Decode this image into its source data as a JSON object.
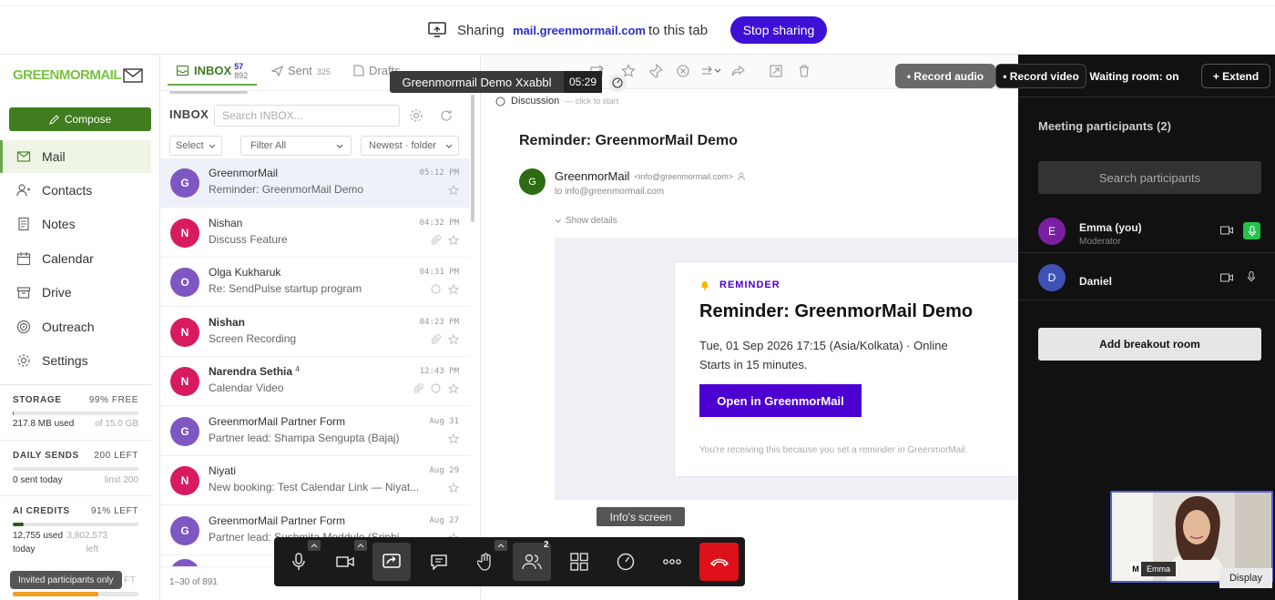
{
  "share_bar": {
    "prefix": "Sharing",
    "domain": "mail.greenmormail.com",
    "suffix": "to this tab",
    "stop_label": "Stop sharing"
  },
  "brand": {
    "logo_text": "GREENMORMAIL",
    "accent": "#3f7d20",
    "logo_color": "#7ac142"
  },
  "compose_label": "Compose",
  "nav": [
    {
      "label": "Mail",
      "icon": "mail-icon",
      "active": true
    },
    {
      "label": "Contacts",
      "icon": "contacts-icon"
    },
    {
      "label": "Notes",
      "icon": "notes-icon"
    },
    {
      "label": "Calendar",
      "icon": "calendar-icon"
    },
    {
      "label": "Drive",
      "icon": "drive-icon"
    },
    {
      "label": "Outreach",
      "icon": "outreach-icon"
    },
    {
      "label": "Settings",
      "icon": "settings-icon"
    }
  ],
  "stats": {
    "storage": {
      "label": "STORAGE",
      "right": "99% FREE",
      "used": "217.8 MB used",
      "limit": "of 15.0 GB",
      "fill": 0.01
    },
    "sends": {
      "label": "DAILY SENDS",
      "right": "200 LEFT",
      "used": "0 sent today",
      "limit": "limit 200",
      "fill": 0.0
    },
    "ai": {
      "label": "AI CREDITS",
      "right": "91% LEFT",
      "used": "12,755 used",
      "used2": "today",
      "limit": "3,802,573",
      "limit2": "left",
      "fill": 0.09
    },
    "fourth": {
      "right": "FT",
      "fill": 0.68
    }
  },
  "invited_tooltip": "Invited participants only",
  "tabs": {
    "inbox": "INBOX",
    "inbox_new": "57",
    "inbox_total": "892",
    "sent": "Sent",
    "sent_count": "325",
    "drafts": "Drafts"
  },
  "list": {
    "title": "INBOX",
    "search_placeholder": "Search INBOX...",
    "filters": {
      "select": "Select",
      "filter": "Filter All",
      "sort": "Newest · folder"
    },
    "footer": "1–30 of 891",
    "rows": [
      {
        "initial": "G",
        "from": "GreenmorMail",
        "subject": "Reminder: GreenmorMail Demo",
        "time": "05:12 PM",
        "color": "#7e57c2",
        "selected": true,
        "bold": false
      },
      {
        "initial": "N",
        "from": "Nishan",
        "subject": "Discuss Feature",
        "time": "04:32 PM",
        "color": "#d81b60"
      },
      {
        "initial": "O",
        "from": "Olga Kukharuk",
        "subject": "Re: SendPulse startup program",
        "time": "04:31 PM",
        "color": "#7e57c2"
      },
      {
        "initial": "N",
        "from": "Nishan",
        "subject": "Screen Recording",
        "time": "04:23 PM",
        "color": "#d81b60",
        "bold": true
      },
      {
        "initial": "N",
        "from": "Narendra Sethia",
        "count": "4",
        "subject": "Calendar Video",
        "time": "12:43 PM",
        "color": "#d81b60",
        "bold": true
      },
      {
        "initial": "G",
        "from": "GreenmorMail Partner Form",
        "subject": "Partner lead: Shampa Sengupta (Bajaj)",
        "time": "Aug 31",
        "color": "#7e57c2"
      },
      {
        "initial": "N",
        "from": "Niyati",
        "subject": "New booking: Test Calendar Link — Niyat...",
        "time": "Aug 29",
        "color": "#d81b60"
      },
      {
        "initial": "G",
        "from": "GreenmorMail Partner Form",
        "subject": "Partner lead: Sushmita Moddule (Sriphi...",
        "time": "Aug 27",
        "color": "#7e57c2"
      }
    ]
  },
  "overlay": {
    "meeting_title": "Greenmormail Demo Xxabbl",
    "timer": "05:29",
    "screen_label": "Info's screen"
  },
  "pane": {
    "discussion": "Discussion",
    "discussion_hint": "— click to start",
    "subject": "Reminder: GreenmorMail Demo",
    "sender_initial": "G",
    "sender_name": "GreenmorMail",
    "sender_email": "<info@greenmormail.com>",
    "to": "to info@greenmormail.com",
    "show_details": "Show details",
    "card": {
      "tag": "REMINDER",
      "title": "Reminder: GreenmorMail Demo",
      "line1": "Tue, 01 Sep 2026 17:15 (Asia/Kolkata) · Online",
      "line2": "Starts in 15 minutes.",
      "button": "Open in GreenmorMail",
      "footer": "You're receiving this because you set a reminder in GreenmorMail.",
      "button_color": "#4b00d1"
    }
  },
  "meeting": {
    "record_audio": "• Record audio",
    "record_video": "• Record video",
    "waiting": "Waiting room: on",
    "extend": "+ Extend",
    "participants_title": "Meeting participants (2)",
    "search_placeholder": "Search participants",
    "people": [
      {
        "initial": "E",
        "name": "Emma (you)",
        "role": "Moderator",
        "color": "#7b1fa2",
        "mic_on": true
      },
      {
        "initial": "D",
        "name": "Daniel",
        "role": "",
        "color": "#3f51b5",
        "mic_on": false
      }
    ],
    "breakout": "Add breakout room",
    "video_name": "Emma",
    "video_badge": "M",
    "display_label": "Display"
  },
  "controls": {
    "participants_count": "2"
  }
}
